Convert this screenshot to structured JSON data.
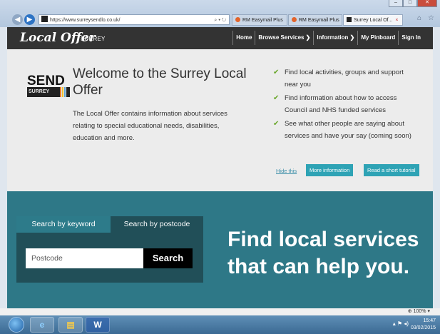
{
  "browser": {
    "url": "https://www.surreysendlo.co.uk/",
    "tabs": [
      {
        "label": "RM Easymail Plus"
      },
      {
        "label": "RM Easymail Plus"
      },
      {
        "label": "Surrey Local Of..."
      }
    ],
    "close_tab": "×"
  },
  "header": {
    "logo": "Local Offer",
    "logo_sub": "SURREY",
    "nav": [
      "Home",
      "Browse Services ❯",
      "Information ❯",
      "My Pinboard",
      "Sign In"
    ]
  },
  "welcome": {
    "send_logo": "SEND",
    "surrey_logo": "SURREY",
    "title": "Welcome to the Surrey Local Offer",
    "body": "The Local Offer contains information about services relating to special educational needs, disabilities, education and more.",
    "features": [
      "Find local activities, groups and support near you",
      "Find information about how to access Council and NHS funded services",
      "See what other people are saying about services and have your say (coming soon)"
    ],
    "hide_link": "Hide this",
    "more_info_button": "More information",
    "tutorial_button": "Read a short tutorial"
  },
  "search": {
    "tab_keyword": "Search by keyword",
    "tab_postcode": "Search by postcode",
    "placeholder": "Postcode",
    "button": "Search",
    "headline": "Find local services that can help you."
  },
  "status": {
    "zoom": "100%"
  },
  "taskbar": {
    "time": "15:47",
    "date": "03/02/2015"
  },
  "colors": {
    "header_bg": "#333333",
    "welcome_bg": "#ececec",
    "hero_bg": "#2e7887",
    "panel_bg": "#214f58",
    "accent": "#2ea3b5",
    "check": "#6aa72b"
  }
}
